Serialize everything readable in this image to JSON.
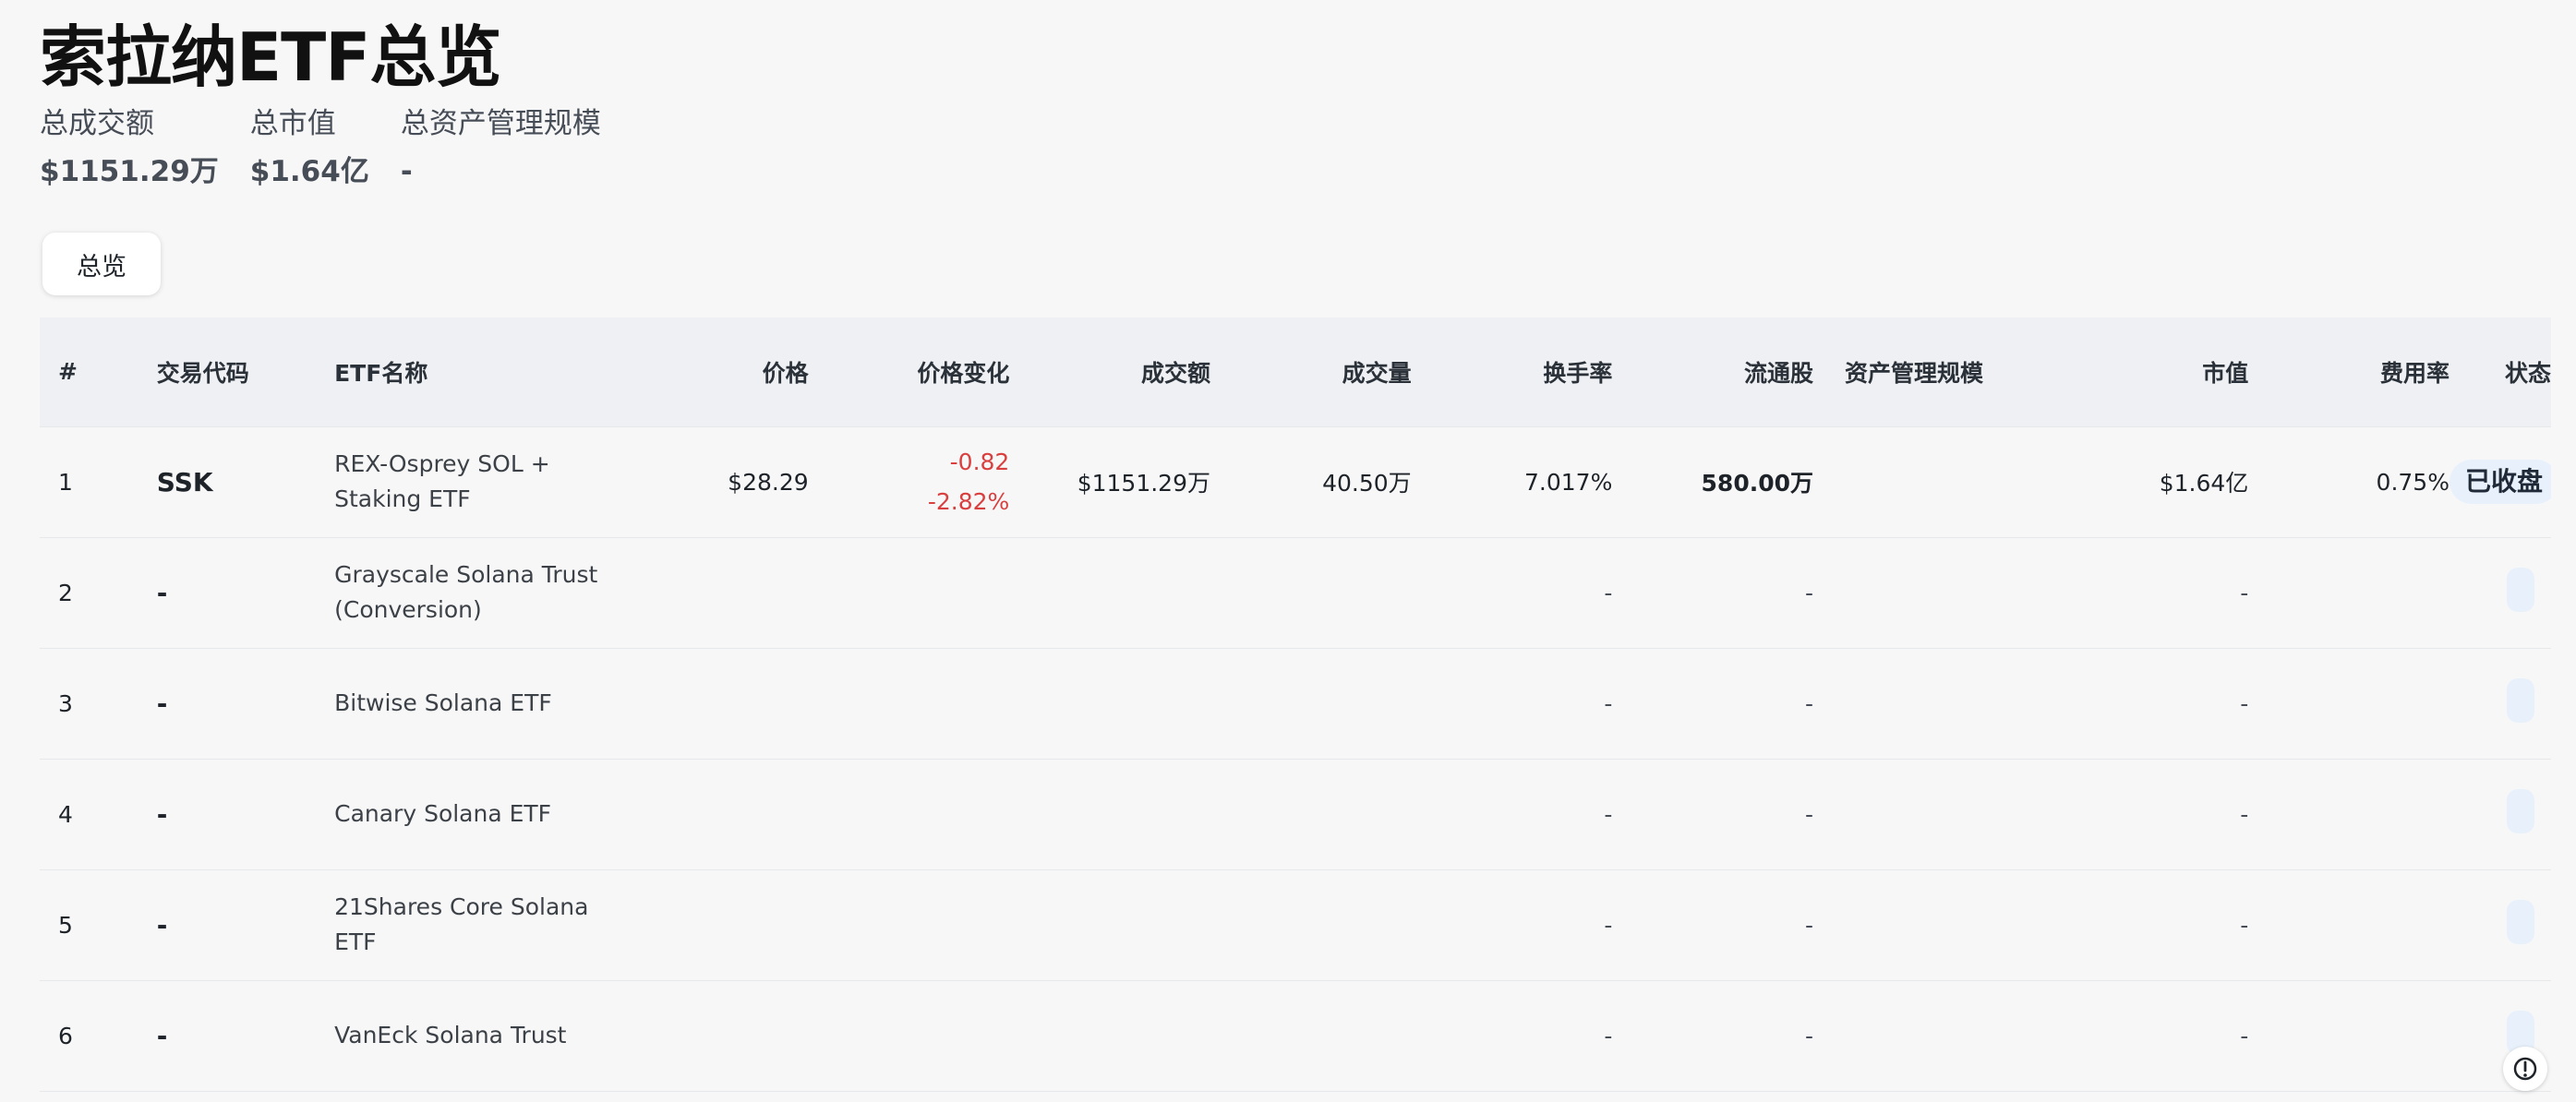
{
  "header": {
    "title": "索拉纳ETF总览"
  },
  "stats": [
    {
      "label": "总成交额",
      "value": "$1151.29万"
    },
    {
      "label": "总市值",
      "value": "$1.64亿"
    },
    {
      "label": "总资产管理规模",
      "value": "-"
    }
  ],
  "tabs": {
    "overview": "总览"
  },
  "table": {
    "headers": [
      "#",
      "交易代码",
      "ETF名称",
      "价格",
      "价格变化",
      "成交额",
      "成交量",
      "换手率",
      "流通股",
      "资产管理规模",
      "市值",
      "费用率",
      "状态"
    ],
    "rows": [
      {
        "num": "1",
        "ticker": "SSK",
        "name": "REX-Osprey SOL + Staking ETF",
        "price": "$28.29",
        "change_abs": "-0.82",
        "change_pct": "-2.82%",
        "amount": "$1151.29万",
        "volume": "40.50万",
        "turnover": "7.017%",
        "float_shares": "580.00万",
        "aum": "",
        "market_cap": "$1.64亿",
        "fee": "0.75%",
        "status": "已收盘"
      },
      {
        "num": "2",
        "ticker": "-",
        "name": "Grayscale Solana Trust (Conversion)",
        "price": "",
        "change_abs": "",
        "change_pct": "",
        "amount": "",
        "volume": "",
        "turnover": "-",
        "float_shares": "-",
        "aum": "",
        "market_cap": "-",
        "fee": "",
        "status": ""
      },
      {
        "num": "3",
        "ticker": "-",
        "name": "Bitwise Solana ETF",
        "price": "",
        "change_abs": "",
        "change_pct": "",
        "amount": "",
        "volume": "",
        "turnover": "-",
        "float_shares": "-",
        "aum": "",
        "market_cap": "-",
        "fee": "",
        "status": ""
      },
      {
        "num": "4",
        "ticker": "-",
        "name": "Canary Solana ETF",
        "price": "",
        "change_abs": "",
        "change_pct": "",
        "amount": "",
        "volume": "",
        "turnover": "-",
        "float_shares": "-",
        "aum": "",
        "market_cap": "-",
        "fee": "",
        "status": ""
      },
      {
        "num": "5",
        "ticker": "-",
        "name": "21Shares Core Solana ETF",
        "price": "",
        "change_abs": "",
        "change_pct": "",
        "amount": "",
        "volume": "",
        "turnover": "-",
        "float_shares": "-",
        "aum": "",
        "market_cap": "-",
        "fee": "",
        "status": ""
      },
      {
        "num": "6",
        "ticker": "-",
        "name": "VanEck Solana Trust",
        "price": "",
        "change_abs": "",
        "change_pct": "",
        "amount": "",
        "volume": "",
        "turnover": "-",
        "float_shares": "-",
        "aum": "",
        "market_cap": "-",
        "fee": "",
        "status": ""
      }
    ]
  },
  "colors": {
    "background": "#f7f7f7",
    "header_background": "#eef0f3",
    "negative": "#d93f3f",
    "status_pill": "#e8f1fb"
  },
  "icons": {
    "help": "feedback-icon"
  }
}
